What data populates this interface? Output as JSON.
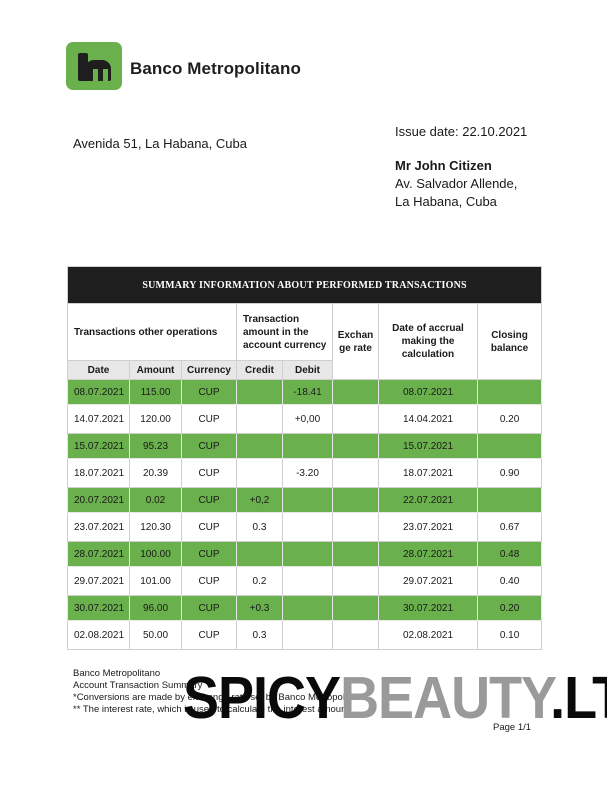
{
  "bank": {
    "name": "Banco Metropolitano",
    "logo_color": "#6ab04c",
    "address": "Avenida 51, La Habana, Cuba"
  },
  "issue_date": "Issue date: 22.10.2021",
  "recipient": {
    "name": "Mr John Citizen",
    "line1": "Av. Salvador Allende,",
    "line2": "La Habana, Cuba"
  },
  "table": {
    "title": "SUMMARY INFORMATION ABOUT PERFORMED TRANSACTIONS",
    "headers": {
      "other_ops": "Transactions other operations",
      "amount_in_currency": "Transaction amount in the account currency",
      "exchange_rate": "Exchan ge rate",
      "accrual_date": "Date of accrual making the calculation",
      "closing_balance": "Closing balance",
      "date": "Date",
      "amount": "Amount",
      "currency": "Currency",
      "credit": "Credit",
      "debit": "Debit"
    },
    "highlight_color": "#6ab04c",
    "rows": [
      {
        "date": "08.07.2021",
        "amount": "115.00",
        "currency": "CUP",
        "credit": "",
        "debit": "-18.41",
        "rate": "",
        "accrual": "08.07.2021",
        "balance": "",
        "style": "g"
      },
      {
        "date": "14.07.2021",
        "amount": "120.00",
        "currency": "CUP",
        "credit": "",
        "debit": "+0,00",
        "rate": "",
        "accrual": "14.04.2021",
        "balance": "0.20",
        "style": "w"
      },
      {
        "date": "15.07.2021",
        "amount": "95.23",
        "currency": "CUP",
        "credit": "",
        "debit": "",
        "rate": "",
        "accrual": "15.07.2021",
        "balance": "",
        "style": "g"
      },
      {
        "date": "18.07.2021",
        "amount": "20.39",
        "currency": "CUP",
        "credit": "",
        "debit": "-3.20",
        "rate": "",
        "accrual": "18.07.2021",
        "balance": "0.90",
        "style": "w"
      },
      {
        "date": "20.07.2021",
        "amount": "0.02",
        "currency": "CUP",
        "credit": "+0,2",
        "debit": "",
        "rate": "",
        "accrual": "22.07.2021",
        "balance": "",
        "style": "g"
      },
      {
        "date": "23.07.2021",
        "amount": "120.30",
        "currency": "CUP",
        "credit": "0.3",
        "debit": "",
        "rate": "",
        "accrual": "23.07.2021",
        "balance": "0.67",
        "style": "w"
      },
      {
        "date": "28.07.2021",
        "amount": "100.00",
        "currency": "CUP",
        "credit": "",
        "debit": "",
        "rate": "",
        "accrual": "28.07.2021",
        "balance": "0.48",
        "style": "g"
      },
      {
        "date": "29.07.2021",
        "amount": "101.00",
        "currency": "CUP",
        "credit": "0.2",
        "debit": "",
        "rate": "",
        "accrual": "29.07.2021",
        "balance": "0.40",
        "style": "w"
      },
      {
        "date": "30.07.2021",
        "amount": "96.00",
        "currency": "CUP",
        "credit": "+0.3",
        "debit": "",
        "rate": "",
        "accrual": "30.07.2021",
        "balance": "0.20",
        "style": "g"
      },
      {
        "date": "02.08.2021",
        "amount": "50.00",
        "currency": "CUP",
        "credit": "0.3",
        "debit": "",
        "rate": "",
        "accrual": "02.08.2021",
        "balance": "0.10",
        "style": "w"
      }
    ]
  },
  "footer": {
    "line1": "Banco Metropolitano",
    "line2": "Account Transaction Summary",
    "line3": "*Conversions are made by exchange rate set by Banco Metropolitano",
    "line4": "** The interest rate, which is used to calculate the interest amount",
    "page": "Page 1/1"
  },
  "watermark": {
    "part1": "SPICY",
    "part2": "BEAUTY",
    "part3": ".LT"
  }
}
